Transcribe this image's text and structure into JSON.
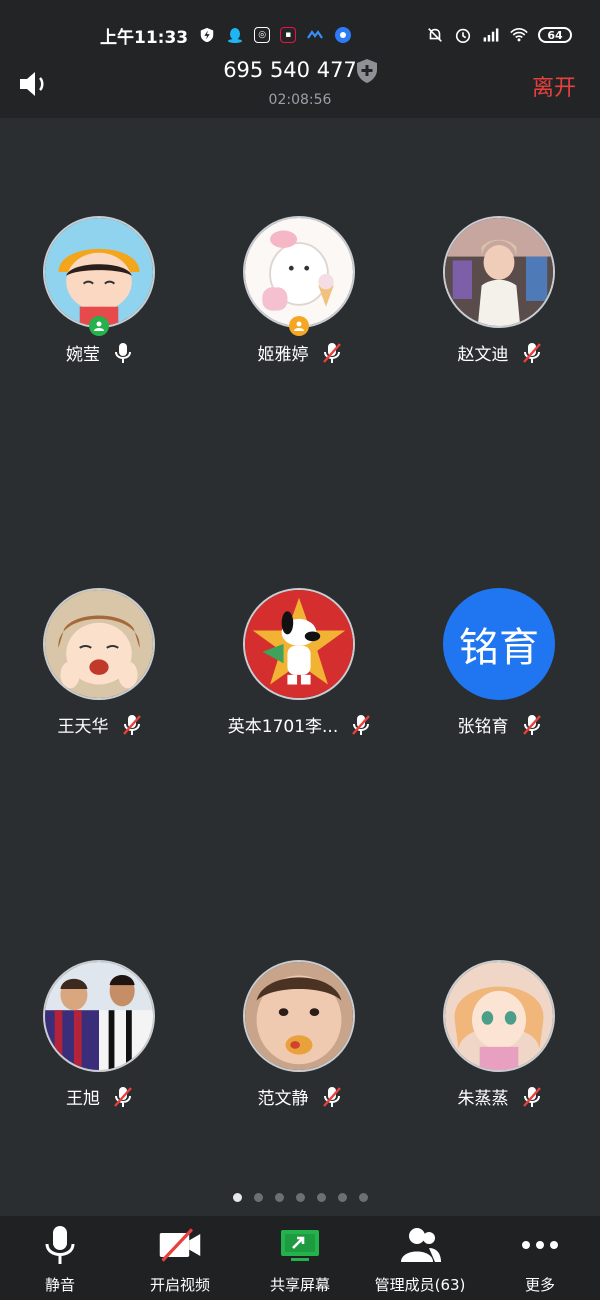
{
  "status_bar": {
    "time": "上午11:33",
    "battery": "64"
  },
  "header": {
    "meeting_id": "695 540 477",
    "duration": "02:08:56",
    "leave_label": "离开"
  },
  "participants": [
    {
      "name": "婉莹",
      "muted": false,
      "role_badge": "green"
    },
    {
      "name": "姬雅婷",
      "muted": true,
      "role_badge": "orange"
    },
    {
      "name": "赵文迪",
      "muted": true
    },
    {
      "name": "王天华",
      "muted": true
    },
    {
      "name": "英本1701李...",
      "muted": true
    },
    {
      "name": "张铭育",
      "muted": true,
      "avatar_text": "铭育"
    },
    {
      "name": "王旭",
      "muted": true
    },
    {
      "name": "范文静",
      "muted": true
    },
    {
      "name": "朱蒸蒸",
      "muted": true
    }
  ],
  "pager": {
    "pages": 7,
    "current": 1
  },
  "toolbar": {
    "mute": "静音",
    "video": "开启视频",
    "share": "共享屏幕",
    "members": "管理成员(63)",
    "more": "更多"
  },
  "colors": {
    "leave": "#e8403c",
    "avatar_blue": "#1f76f0",
    "share_green": "#23b24b"
  }
}
